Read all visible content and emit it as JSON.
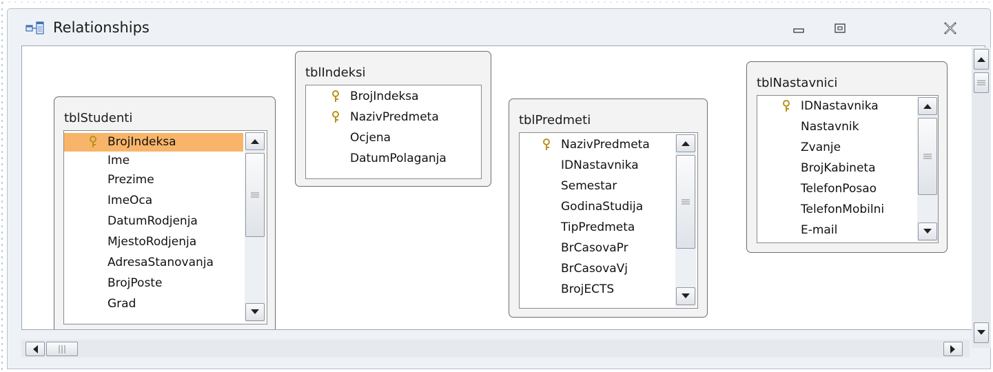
{
  "window": {
    "title": "Relationships",
    "icon": "relationships-icon",
    "controls": [
      "minimize-icon",
      "restore-icon",
      "close-icon"
    ]
  },
  "tables": [
    {
      "name": "tblStudenti",
      "fields": [
        {
          "label": "BrojIndeksa",
          "key": true,
          "selected": true
        },
        {
          "label": "Ime",
          "key": false
        },
        {
          "label": "Prezime",
          "key": false
        },
        {
          "label": "ImeOca",
          "key": false
        },
        {
          "label": "DatumRodjenja",
          "key": false
        },
        {
          "label": "MjestoRodjenja",
          "key": false
        },
        {
          "label": "AdresaStanovanja",
          "key": false
        },
        {
          "label": "BrojPoste",
          "key": false
        },
        {
          "label": "Grad",
          "key": false
        }
      ]
    },
    {
      "name": "tblIndeksi",
      "fields": [
        {
          "label": "BrojIndeksa",
          "key": true
        },
        {
          "label": "NazivPredmeta",
          "key": true
        },
        {
          "label": "Ocjena",
          "key": false
        },
        {
          "label": "DatumPolaganja",
          "key": false
        }
      ]
    },
    {
      "name": "tblPredmeti",
      "fields": [
        {
          "label": "NazivPredmeta",
          "key": true
        },
        {
          "label": "IDNastavnika",
          "key": false
        },
        {
          "label": "Semestar",
          "key": false
        },
        {
          "label": "GodinaStudija",
          "key": false
        },
        {
          "label": "TipPredmeta",
          "key": false
        },
        {
          "label": "BrCasovaPr",
          "key": false
        },
        {
          "label": "BrCasovaVj",
          "key": false
        },
        {
          "label": "BrojECTS",
          "key": false
        }
      ]
    },
    {
      "name": "tblNastavnici",
      "fields": [
        {
          "label": "IDNastavnika",
          "key": true
        },
        {
          "label": "Nastavnik",
          "key": false
        },
        {
          "label": "Zvanje",
          "key": false
        },
        {
          "label": "BrojKabineta",
          "key": false
        },
        {
          "label": "TelefonPosao",
          "key": false
        },
        {
          "label": "TelefonMobilni",
          "key": false
        },
        {
          "label": "E-mail",
          "key": false
        }
      ]
    }
  ],
  "colors": {
    "selected_row": "#f8b56a",
    "window_frame": "#eef2f7",
    "key_icon": "#c9a227"
  }
}
